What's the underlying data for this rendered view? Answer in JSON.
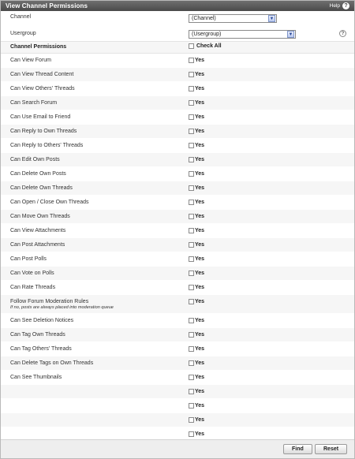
{
  "titlebar": {
    "title": "View Channel Permissions",
    "help_label": "Help"
  },
  "form": {
    "channel_label": "Channel",
    "channel_value": "(Channel)",
    "usergroup_label": "Usergroup",
    "usergroup_value": "(Usergroup)"
  },
  "permissions_header": "Channel Permissions",
  "check_all_label": "Check All",
  "yes_label": "Yes",
  "permissions": [
    {
      "label": "Can View Forum"
    },
    {
      "label": "Can View Thread Content"
    },
    {
      "label": "Can View Others' Threads"
    },
    {
      "label": "Can Search Forum"
    },
    {
      "label": "Can Use Email to Friend"
    },
    {
      "label": "Can Reply to Own Threads"
    },
    {
      "label": "Can Reply to Others' Threads"
    },
    {
      "label": "Can Edit Own Posts"
    },
    {
      "label": "Can Delete Own Posts"
    },
    {
      "label": "Can Delete Own Threads"
    },
    {
      "label": "Can Open / Close Own Threads"
    },
    {
      "label": "Can Move Own Threads"
    },
    {
      "label": "Can View Attachments"
    },
    {
      "label": "Can Post Attachments"
    },
    {
      "label": "Can Post Polls"
    },
    {
      "label": "Can Vote on Polls"
    },
    {
      "label": "Can Rate Threads"
    },
    {
      "label": "Follow Forum Moderation Rules",
      "note": "If no, posts are always placed into moderation queue"
    },
    {
      "label": "Can See Deletion Notices"
    },
    {
      "label": "Can Tag Own Threads"
    },
    {
      "label": "Can Tag Others' Threads"
    },
    {
      "label": "Can Delete Tags on Own Threads"
    },
    {
      "label": "Can See Thumbnails"
    },
    {
      "label": ""
    },
    {
      "label": ""
    },
    {
      "label": ""
    },
    {
      "label": ""
    },
    {
      "label": ""
    }
  ],
  "buttons": {
    "find": "Find",
    "reset": "Reset"
  }
}
